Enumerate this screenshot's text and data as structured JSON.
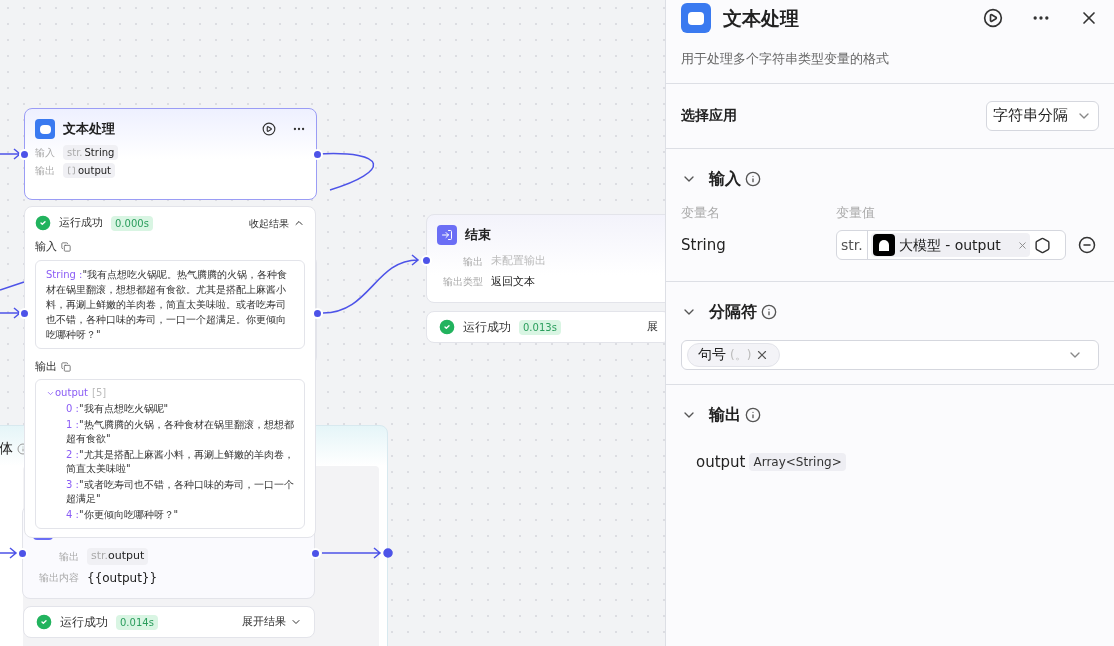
{
  "canvas": {
    "text_node": {
      "title": "文本处理",
      "rows": [
        {
          "label": "输入",
          "kind": "string",
          "type": "str.",
          "name": "String"
        },
        {
          "label": "输出",
          "kind": "array",
          "name": "output"
        }
      ]
    },
    "text_result": {
      "status_text": "运行成功",
      "time": "0.000s",
      "toggle": "收起结果",
      "expanded": true,
      "input_label": "输入",
      "input_key": "String :",
      "input_value": "\"我有点想吃火锅呢。热气腾腾的火锅，各种食材在锅里翻滚，想想都超有食欲。尤其是搭配上麻酱小料，再涮上鲜嫩的羊肉卷，简直太美味啦。或者吃寿司也不错，各种口味的寿司，一口一个超满足。你更倾向吃哪种呀？\"",
      "output_label": "输出",
      "output_name": "output",
      "output_count": "[5]",
      "output_expanded": true,
      "items": [
        {
          "key": "0 :",
          "value": "\"我有点想吃火锅呢\""
        },
        {
          "key": "1 :",
          "value": "\"热气腾腾的火锅，各种食材在锅里翻滚，想想都超有食欲\""
        },
        {
          "key": "2 :",
          "value": "\"尤其是搭配上麻酱小料，再涮上鲜嫩的羊肉卷，简直太美味啦\""
        },
        {
          "key": "3 :",
          "value": "\"或者吃寿司也不错，各种口味的寿司，一口一个超满足\""
        },
        {
          "key": "4 :",
          "value": "\"你更倾向吃哪种呀？\""
        }
      ]
    },
    "loop": {
      "title": "体"
    },
    "output_node": {
      "rows": [
        {
          "label": "输出",
          "kind": "var",
          "type": "str.",
          "value": "output"
        },
        {
          "label": "输出内容",
          "kind": "text",
          "value": "{{output}}"
        }
      ],
      "result": {
        "status_text": "运行成功",
        "time": "0.014s",
        "toggle": "展开结果",
        "expanded": false
      }
    },
    "end_node": {
      "title": "结束",
      "rows": [
        {
          "label": "输出",
          "value": "未配置输出",
          "muted": true
        },
        {
          "label": "输出类型",
          "value": "返回文本",
          "muted": false
        }
      ],
      "result": {
        "status_text": "运行成功",
        "time": "0.013s",
        "toggle": "展"
      }
    }
  },
  "panel": {
    "title": "文本处理",
    "description": "用于处理多个字符串类型变量的格式",
    "app": {
      "label": "选择应用",
      "value": "字符串分隔"
    },
    "input": {
      "title": "输入",
      "expanded": true,
      "col_name": "变量名",
      "col_value": "变量值",
      "vars": [
        {
          "name": "String",
          "type": "str.",
          "reference": "大模型 - output"
        }
      ]
    },
    "separator": {
      "title": "分隔符",
      "expanded": true,
      "tags": [
        {
          "label": "句号",
          "symbol": "(。)"
        }
      ]
    },
    "output": {
      "title": "输出",
      "expanded": true,
      "vars": [
        {
          "name": "output",
          "type": "Array<String>"
        }
      ]
    }
  }
}
